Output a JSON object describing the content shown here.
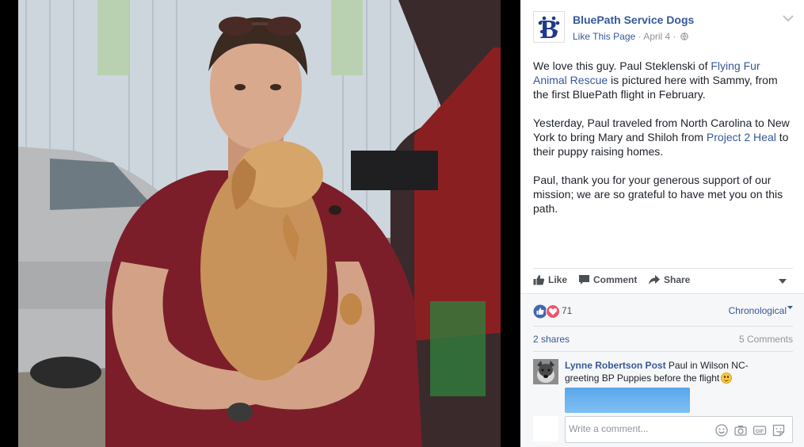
{
  "colors": {
    "link": "#365899",
    "text": "#1d2129",
    "muted": "#90949c",
    "like_blue": "#4267b2",
    "love_red": "#f25268"
  },
  "post": {
    "page_name": "BluePath Service Dogs",
    "like_page": "Like This Page",
    "sep1": " · ",
    "date": "April 4",
    "sep2": " · ",
    "paragraphs": [
      {
        "t1": "We love this guy. Paul Steklenski of ",
        "link1": "Flying Fur Animal Rescue",
        "t2": " is pictured here with Sammy, from the first BluePath flight in February."
      },
      {
        "t1": "Yesterday, Paul traveled from North Carolina to New York to bring Mary and Shiloh from ",
        "link1": "Project 2 Heal",
        "t2": " to their puppy raising homes."
      },
      {
        "t1": "Paul, thank you for your generous support of our mission; we are so grateful to have met you on this path."
      }
    ]
  },
  "actions": {
    "like": "Like",
    "comment": "Comment",
    "share": "Share"
  },
  "icons": {
    "avatar": "bluepath-paw-b-logo",
    "globe": "globe-icon",
    "like": "thumbs-up-icon",
    "comment": "speech-bubble-icon",
    "share": "share-arrow-icon",
    "menu": "chevron-down-icon",
    "reactions": [
      "like-reaction-icon",
      "love-reaction-icon"
    ],
    "input": [
      "emoji-icon",
      "camera-icon",
      "gif-icon",
      "sticker-icon"
    ]
  },
  "engagement": {
    "reaction_count": "71",
    "sort": "Chronological",
    "shares": "2 shares",
    "comments": "5 Comments"
  },
  "comment": {
    "author": "Lynne Robertson Post",
    "text": " Paul in Wilson NC- greeting BP Puppies before the flight"
  },
  "write_comment": {
    "placeholder": "Write a comment..."
  }
}
